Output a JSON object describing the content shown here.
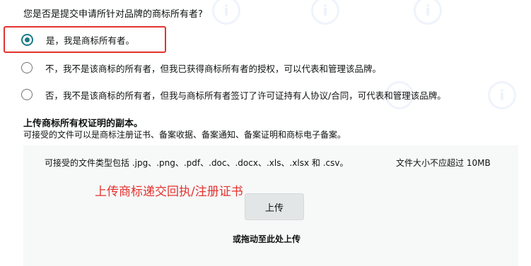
{
  "question": "您是否是提交申请所针对品牌的商标所有者?",
  "options": [
    {
      "label": "是，我是商标所有者。",
      "checked": true
    },
    {
      "label": "不，我不是该商标的所有者，但我已获得商标所有者的授权，可以代表和管理该品牌。",
      "checked": false
    },
    {
      "label": "否，我不是该商标的所有者，但我与商标所有者签订了许可证持有人协议/合同，可代表和管理该品牌。",
      "checked": false
    }
  ],
  "upload": {
    "title": "上传商标所有权证明的副本。",
    "description": "可接受的文件可以是商标注册证书、备案收据、备案通知、备案证明和商标电子备案。",
    "file_types": "可接受的文件类型包括 .jpg、.png、.pdf、.doc、.docx、.xls、.xlsx 和 .csv。",
    "size_limit": "文件大小不应超过 10MB",
    "annotation": "上传商标递交回执/注册证书",
    "button_label": "上传",
    "drag_text": "或拖动至此处上传"
  },
  "colors": {
    "accent": "#1b7a86",
    "annotation_red": "#e3332f",
    "upload_bg": "#f7f8f8"
  }
}
